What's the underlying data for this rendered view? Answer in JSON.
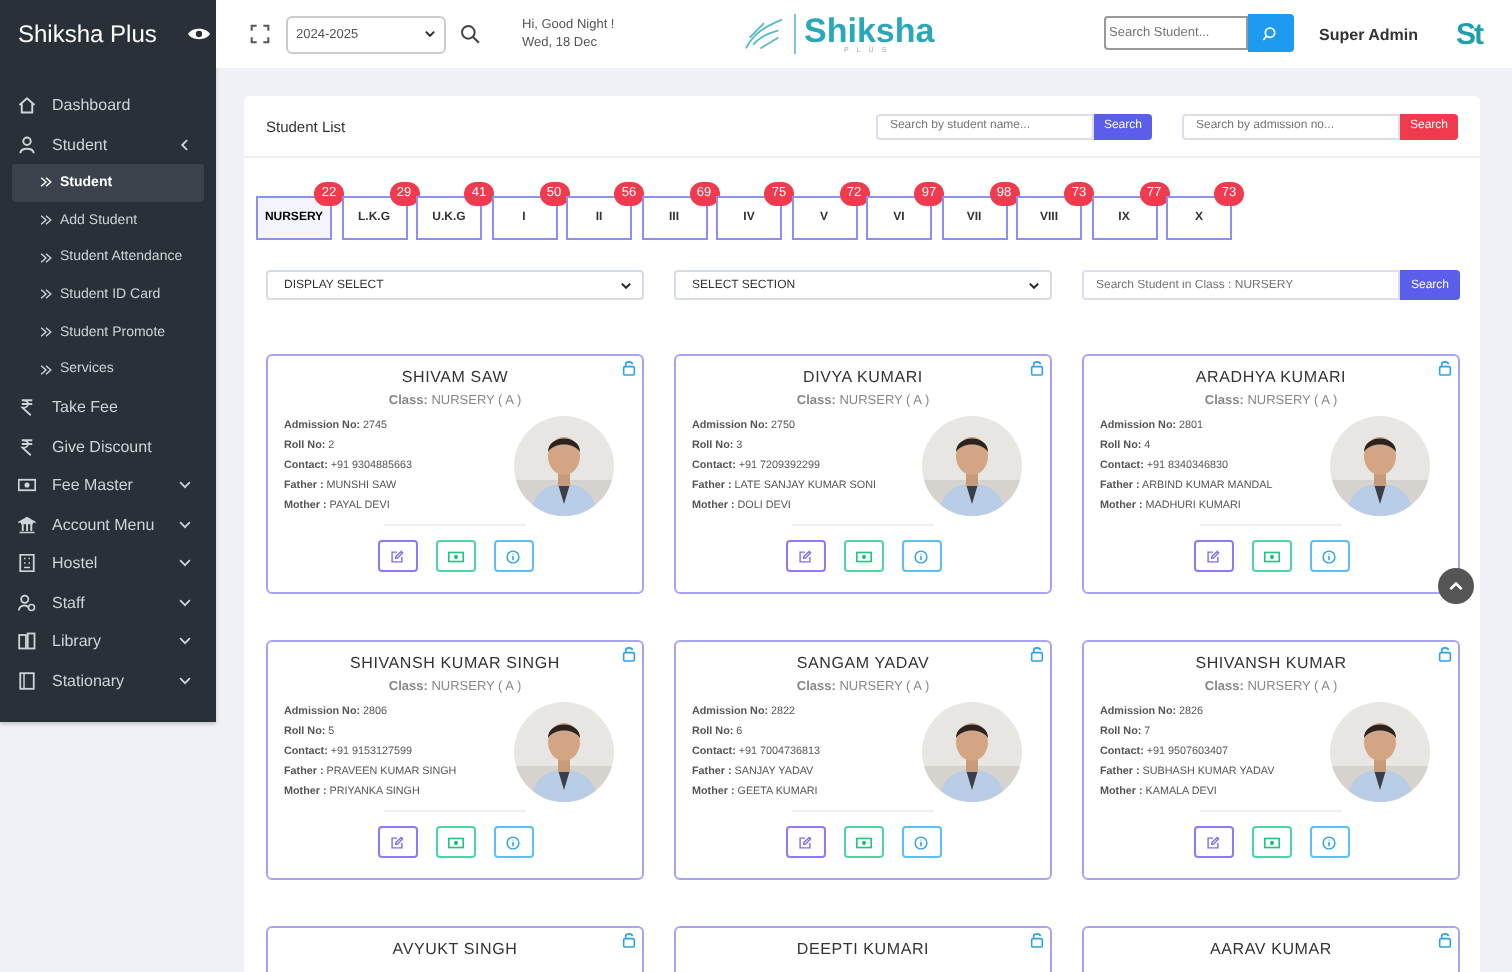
{
  "sidebar": {
    "brand": "Shiksha Plus",
    "items": [
      {
        "label": "Dashboard",
        "selected": false
      },
      {
        "label": "Student",
        "selected": false,
        "expanded": true,
        "children": [
          {
            "label": "Student",
            "selected": true
          },
          {
            "label": "Add Student",
            "selected": false
          },
          {
            "label": "Student Attendance",
            "selected": false
          },
          {
            "label": "Student ID Card",
            "selected": false
          },
          {
            "label": "Student Promote",
            "selected": false
          },
          {
            "label": "Services",
            "selected": false
          }
        ]
      },
      {
        "label": "Take Fee",
        "selected": false
      },
      {
        "label": "Give Discount",
        "selected": false
      },
      {
        "label": "Fee Master",
        "selected": false,
        "expanded": false
      },
      {
        "label": "Account Menu",
        "selected": false,
        "expanded": false
      },
      {
        "label": "Hostel",
        "selected": false,
        "expanded": false
      },
      {
        "label": "Staff",
        "selected": false,
        "expanded": false
      },
      {
        "label": "Library",
        "selected": false,
        "expanded": false
      },
      {
        "label": "Stationary",
        "selected": false,
        "expanded": false
      }
    ]
  },
  "header": {
    "session": "2024-2025",
    "greeting": "Hi, Good Night !",
    "date": "Wed, 18 Dec",
    "logo": "Shiksha",
    "logo_sub": "PLUS",
    "search": {
      "placeholder": "Search Student..."
    },
    "user": "Super Admin",
    "avatar": "St"
  },
  "panel": {
    "title": "Student List",
    "name_search": {
      "placeholder": "Search by student name...",
      "button": "Search"
    },
    "admission_search": {
      "placeholder": "Search by admission no...",
      "button": "Search"
    },
    "classes": [
      {
        "label": "NURSERY",
        "count": "22",
        "selected": true
      },
      {
        "label": "L.K.G",
        "count": "29",
        "selected": false
      },
      {
        "label": "U.K.G",
        "count": "41",
        "selected": false
      },
      {
        "label": "I",
        "count": "50",
        "selected": false
      },
      {
        "label": "II",
        "count": "56",
        "selected": false
      },
      {
        "label": "III",
        "count": "69",
        "selected": false
      },
      {
        "label": "IV",
        "count": "75",
        "selected": false
      },
      {
        "label": "V",
        "count": "72",
        "selected": false
      },
      {
        "label": "VI",
        "count": "97",
        "selected": false
      },
      {
        "label": "VII",
        "count": "98",
        "selected": false
      },
      {
        "label": "VIII",
        "count": "73",
        "selected": false
      },
      {
        "label": "IX",
        "count": "77",
        "selected": false
      },
      {
        "label": "X",
        "count": "73",
        "selected": false
      }
    ],
    "display_select": "DISPLAY SELECT",
    "section_select": "SELECT SECTION",
    "class_search": {
      "placeholder": "Search Student in Class : NURSERY",
      "button": "Search"
    },
    "students": [
      {
        "name": "SHIVAM SAW",
        "class": "**Class:** NURSERY ( A )",
        "fields": [
          "**Admission No:** 2745",
          "**Roll No:** 2",
          "**Contact:** +91 9304885663",
          "**Father :** MUNSHI SAW",
          "**Mother :** PAYAL DEVI"
        ]
      },
      {
        "name": "DIVYA KUMARI",
        "class": "**Class:** NURSERY ( A )",
        "fields": [
          "**Admission No:** 2750",
          "**Roll No:** 3",
          "**Contact:** +91 7209392299",
          "**Father :** LATE SANJAY KUMAR SONI",
          "**Mother :** DOLI DEVI"
        ]
      },
      {
        "name": "ARADHYA KUMARI",
        "class": "**Class:** NURSERY ( A )",
        "fields": [
          "**Admission No:** 2801",
          "**Roll No:** 4",
          "**Contact:** +91 8340346830",
          "**Father :** ARBIND KUMAR MANDAL",
          "**Mother :** MADHURI KUMARI"
        ]
      },
      {
        "name": "SHIVANSH KUMAR SINGH",
        "class": "**Class:** NURSERY ( A )",
        "fields": [
          "**Admission No:** 2806",
          "**Roll No:** 5",
          "**Contact:** +91 9153127599",
          "**Father :** PRAVEEN KUMAR SINGH",
          "**Mother :** PRIYANKA SINGH"
        ]
      },
      {
        "name": "SANGAM YADAV",
        "class": "**Class:** NURSERY ( A )",
        "fields": [
          "**Admission No:** 2822",
          "**Roll No:** 6",
          "**Contact:** +91 7004736813",
          "**Father :** SANJAY YADAV",
          "**Mother :** GEETA KUMARI"
        ]
      },
      {
        "name": "SHIVANSH KUMAR",
        "class": "**Class:** NURSERY ( A )",
        "fields": [
          "**Admission No:** 2826",
          "**Roll No:** 7",
          "**Contact:** +91 9507603407",
          "**Father :** SUBHASH KUMAR YADAV",
          "**Mother :** KAMALA DEVI"
        ]
      },
      {
        "name": "AVYUKT SINGH"
      },
      {
        "name": "DEEPTI KUMARI"
      },
      {
        "name": "AARAV KUMAR"
      }
    ]
  }
}
